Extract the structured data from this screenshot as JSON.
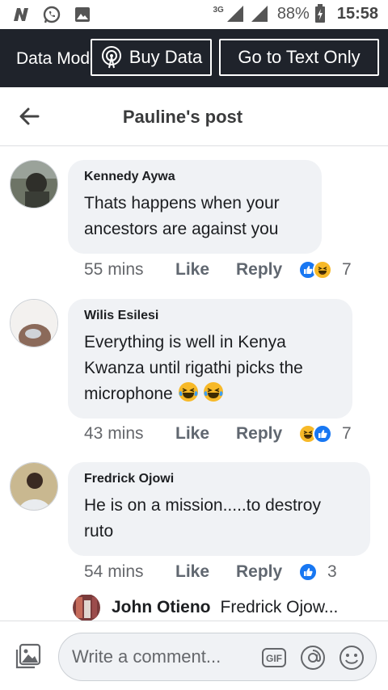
{
  "status_bar": {
    "network": "3G",
    "battery": "88%",
    "time": "15:58"
  },
  "data_bar": {
    "mode_label": "Data Mode",
    "buy_label": "Buy Data",
    "text_only_label": "Go to Text Only"
  },
  "header": {
    "title": "Pauline's post"
  },
  "comments": [
    {
      "author": "Kennedy Aywa",
      "text": "Thats happens when your ancestors are against you",
      "time": "55 mins",
      "like": "Like",
      "reply": "Reply",
      "reactions": [
        "like-reaction",
        "haha-reaction"
      ],
      "count": "7"
    },
    {
      "author": "Wilis Esilesi",
      "text": "Everything is well in Kenya Kwanza until rigathi picks the microphone",
      "emojis": [
        "tears-of-joy-emoji",
        "tears-of-joy-emoji"
      ],
      "time": "43 mins",
      "like": "Like",
      "reply": "Reply",
      "reactions": [
        "haha-reaction",
        "like-reaction"
      ],
      "count": "7"
    },
    {
      "author": "Fredrick Ojowi",
      "text": "He is on a mission.....to destroy ruto",
      "time": "54 mins",
      "like": "Like",
      "reply": "Reply",
      "reactions": [
        "like-reaction"
      ],
      "count": "3"
    }
  ],
  "reply_preview": {
    "author": "John Otieno",
    "text": "Fredrick Ojow..."
  },
  "composer": {
    "placeholder": "Write a comment...",
    "gif_label": "GIF"
  },
  "colors": {
    "data_bar_bg": "#1f232b",
    "bubble_bg": "#f0f2f5",
    "like_blue": "#1877f2",
    "haha_yellow": "#f7b928"
  }
}
